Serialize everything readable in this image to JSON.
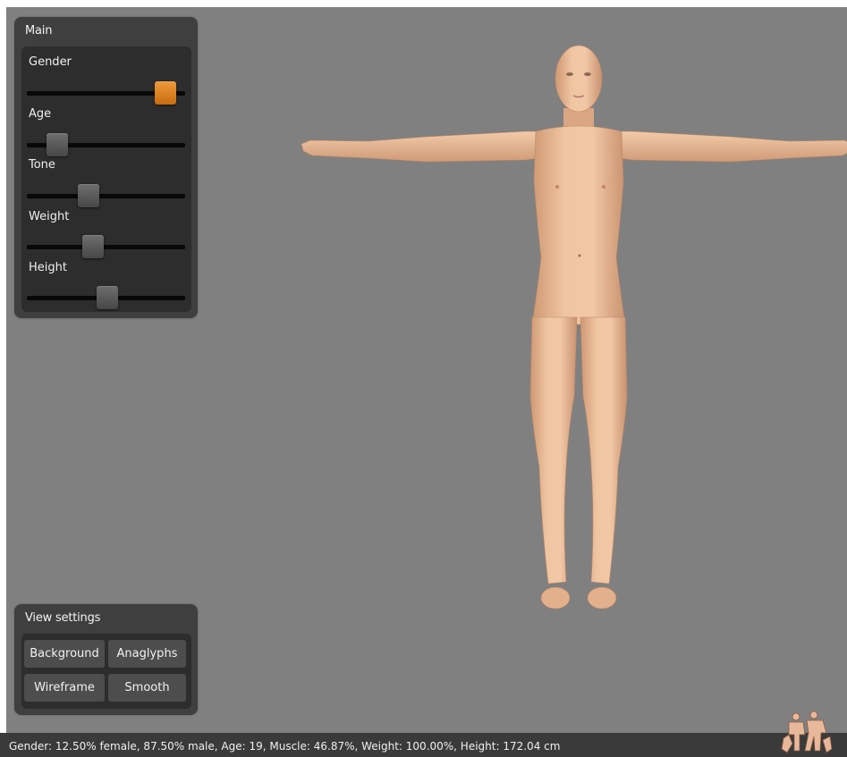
{
  "main_panel": {
    "title": "Main",
    "sliders": [
      {
        "label": "Gender",
        "value": 0.875,
        "active": true
      },
      {
        "label": "Age",
        "value": 0.19,
        "active": false
      },
      {
        "label": "Tone",
        "value": 0.39,
        "active": false
      },
      {
        "label": "Weight",
        "value": 0.42,
        "active": false
      },
      {
        "label": "Height",
        "value": 0.51,
        "active": false
      }
    ]
  },
  "view_panel": {
    "title": "View settings",
    "buttons": {
      "background": "Background",
      "anaglyphs": "Anaglyphs",
      "wireframe": "Wireframe",
      "smooth": "Smooth"
    }
  },
  "status_bar": {
    "text": "Gender: 12.50% female, 87.50% male, Age: 19, Muscle: 46.87%, Weight: 100.00%, Height: 172.04 cm"
  },
  "colors": {
    "viewport_bg": "#808080",
    "panel_bg": "#3f3f3f",
    "accent": "#e08a24",
    "skin": "#e8b894"
  },
  "icons": {
    "logo": "makehuman-logo-icon"
  }
}
